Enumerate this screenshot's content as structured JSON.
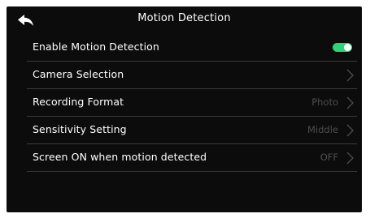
{
  "header": {
    "title": "Motion Detection",
    "back_icon": "back-arrow-icon"
  },
  "colors": {
    "background": "#0c0c0c",
    "text": "#ffffff",
    "muted_text": "#4d4d4d",
    "divider": "#3a3a3a",
    "toggle_on": "#2fd17a"
  },
  "settings": [
    {
      "label": "Enable Motion Detection",
      "control": "toggle",
      "state": "on"
    },
    {
      "label": "Camera Selection",
      "value": ""
    },
    {
      "label": "Recording Format",
      "value": "Photo"
    },
    {
      "label": "Sensitivity Setting",
      "value": "Middle"
    },
    {
      "label": "Screen ON when motion detected",
      "value": "OFF"
    }
  ]
}
